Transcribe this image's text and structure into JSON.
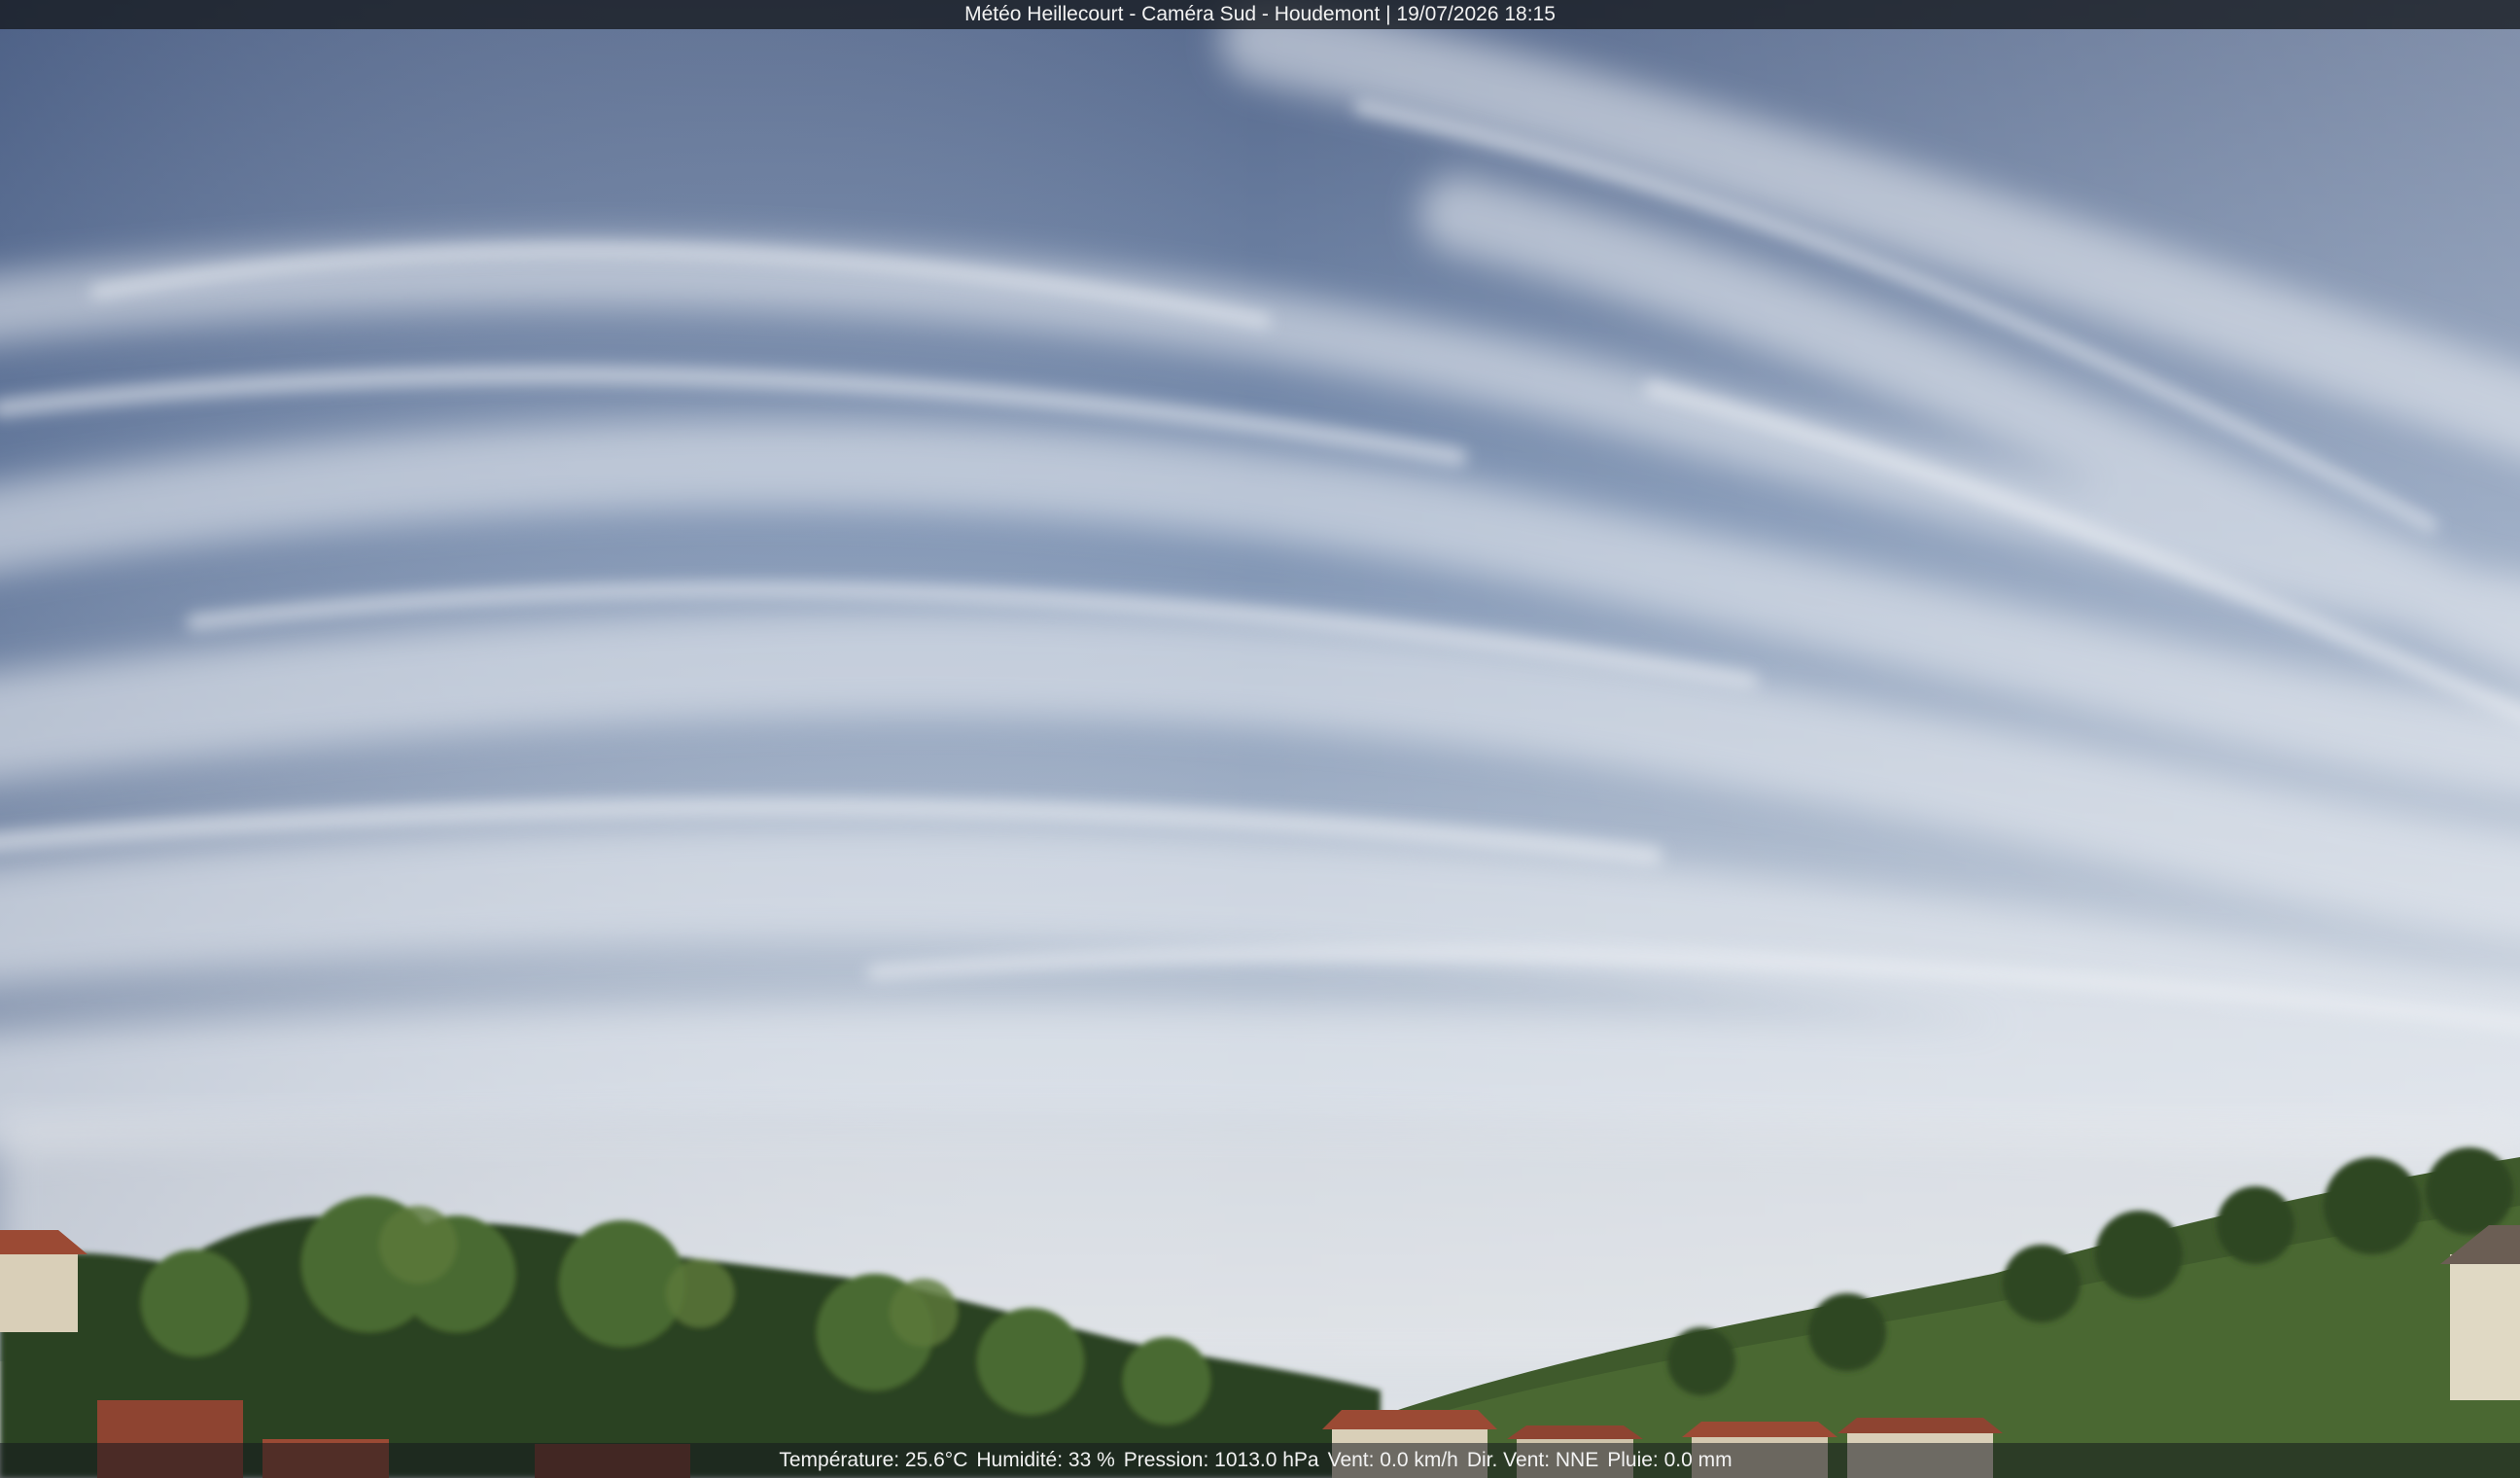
{
  "overlay": {
    "title": "Météo Heillecourt - Caméra Sud - Houdemont | 19/07/2026 18:15",
    "temperature": "Température: 25.6°C",
    "humidity": "Humidité: 33 %",
    "pressure": "Pression: 1013.0 hPa",
    "wind_speed": "Vent: 0.0 km/h",
    "wind_direction": "Dir. Vent: NNE",
    "rain": "Pluie: 0.0 mm"
  },
  "colors": {
    "sky_top": "#5b7197",
    "sky_mid": "#8ea2c0",
    "sky_horizon": "#dfe3e8",
    "cloud": "#eef1f5",
    "hill": "#3f5a2c",
    "trees_dark": "#2b4220",
    "trees_light": "#5c7a3a",
    "roof": "#9b4a34",
    "wall": "#d9cfb8"
  }
}
